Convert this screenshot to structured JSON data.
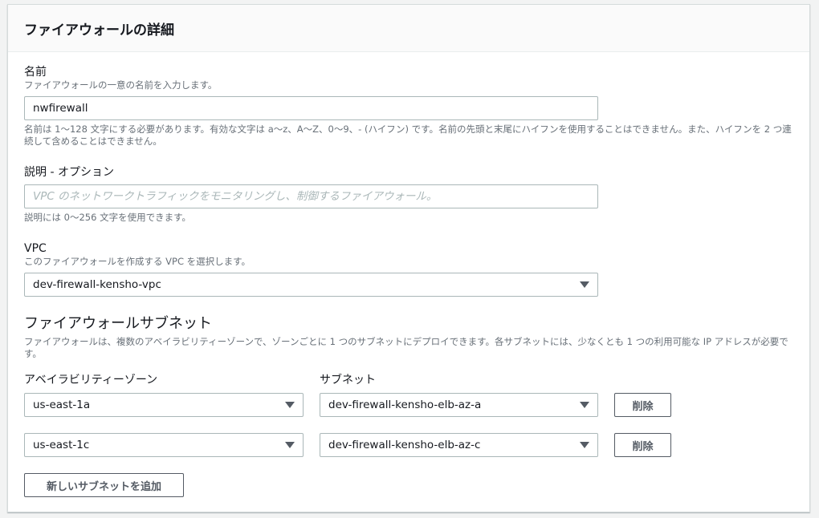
{
  "panel": {
    "title": "ファイアウォールの詳細"
  },
  "name_field": {
    "label": "名前",
    "description": "ファイアウォールの一意の名前を入力します。",
    "value": "nwfirewall",
    "constraint": "名前は 1〜128 文字にする必要があります。有効な文字は a〜z、A〜Z、0〜9、- (ハイフン) です。名前の先頭と末尾にハイフンを使用することはできません。また、ハイフンを 2 つ連続して含めることはできません。"
  },
  "description_field": {
    "label": "説明 - オプション",
    "placeholder": "VPC のネットワークトラフィックをモニタリングし、制御するファイアウォール。",
    "constraint": "説明には 0〜256 文字を使用できます。"
  },
  "vpc_field": {
    "label": "VPC",
    "description": "このファイアウォールを作成する VPC を選択します。",
    "selected": "dev-firewall-kensho-vpc"
  },
  "subnets": {
    "title": "ファイアウォールサブネット",
    "description": "ファイアウォールは、複数のアベイラビリティーゾーンで、ゾーンごとに 1 つのサブネットにデプロイできます。各サブネットには、少なくとも 1 つの利用可能な IP アドレスが必要です。",
    "az_header": "アベイラビリティーゾーン",
    "subnet_header": "サブネット",
    "rows": [
      {
        "az": "us-east-1a",
        "subnet": "dev-firewall-kensho-elb-az-a",
        "remove_label": "削除"
      },
      {
        "az": "us-east-1c",
        "subnet": "dev-firewall-kensho-elb-az-c",
        "remove_label": "削除"
      }
    ],
    "add_label": "新しいサブネットを追加"
  },
  "icons": {
    "dropdown": "caret-down-icon"
  },
  "colors": {
    "border": "#aab7b8",
    "text": "#16191f",
    "muted": "#687078",
    "button_border": "#545b64"
  }
}
